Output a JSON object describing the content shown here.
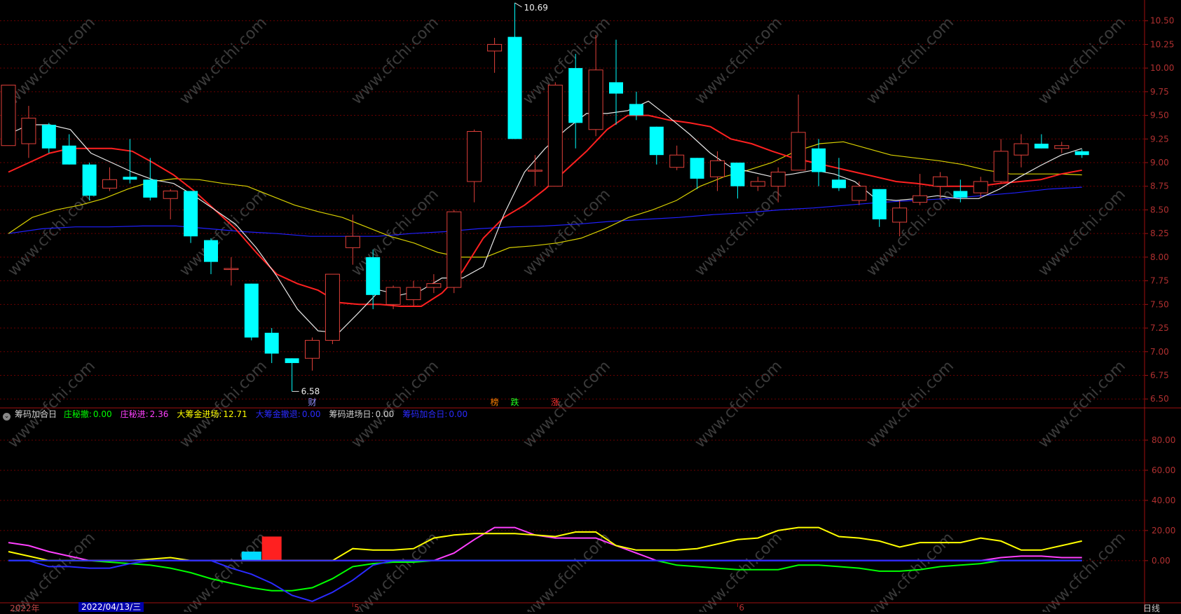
{
  "colors": {
    "background": "#000000",
    "up": "#e0403a",
    "down": "#00ffff",
    "ma5": "#e8e8e8",
    "ma10": "#ff2020",
    "ma20": "#d8d000",
    "ma60": "#2020ff",
    "axis": "#a01010",
    "grid": "#6a0000"
  },
  "price_axis_labels": [
    "10.50",
    "10.25",
    "10.00",
    "9.75",
    "9.50",
    "9.25",
    "9.00",
    "8.75",
    "8.50",
    "8.25",
    "8.00",
    "7.75",
    "7.50",
    "7.25",
    "7.00",
    "6.75",
    "6.50"
  ],
  "indicator_axis_labels": [
    "80.00",
    "60.00",
    "40.00",
    "20.00",
    "0.00"
  ],
  "high_label": "10.69",
  "low_label": "6.58",
  "event_markers": [
    {
      "text": "财",
      "color": "#9090ff",
      "bar": 15
    },
    {
      "text": "榜",
      "color": "#ff8000",
      "bar": 24
    },
    {
      "text": "跌",
      "color": "#20ff20",
      "bar": 25
    },
    {
      "text": "涨",
      "color": "#ff3030",
      "bar": 27
    }
  ],
  "indicator": {
    "name": "筹码加合日",
    "items": [
      {
        "label": "庄秘撤:",
        "value": "0.00",
        "color": "#00ff00"
      },
      {
        "label": "庄秘进:",
        "value": "2.36",
        "color": "#ff40ff"
      },
      {
        "label": "大筹金进场:",
        "value": "12.71",
        "color": "#ffff00"
      },
      {
        "label": "大筹金撤退:",
        "value": "0.00",
        "color": "#2a2aff"
      },
      {
        "label": "筹码进场日:",
        "value": "0.00",
        "color": "#d0d0d0"
      },
      {
        "label": "筹码加合日:",
        "value": "0.00",
        "color": "#2a2aff"
      }
    ]
  },
  "bottom_axis": {
    "year": "2022年",
    "current_date": "2022/04/13/三",
    "month_labels": [
      {
        "text": "5",
        "bar": 17
      },
      {
        "text": "6",
        "bar": 36
      }
    ],
    "period": "日线"
  },
  "watermark": "www.cfchi.com",
  "chart_data": [
    {
      "type": "candlestick",
      "ylim": [
        6.42,
        10.72
      ],
      "candles": [
        {
          "o": 9.18,
          "h": 9.82,
          "l": 9.18,
          "c": 9.82
        },
        {
          "o": 9.2,
          "h": 9.6,
          "l": 9.05,
          "c": 9.47
        },
        {
          "o": 9.4,
          "h": 9.42,
          "l": 9.1,
          "c": 9.15
        },
        {
          "o": 9.18,
          "h": 9.3,
          "l": 8.98,
          "c": 8.98
        },
        {
          "o": 8.98,
          "h": 9.0,
          "l": 8.6,
          "c": 8.65
        },
        {
          "o": 8.73,
          "h": 8.95,
          "l": 8.7,
          "c": 8.82
        },
        {
          "o": 8.85,
          "h": 9.25,
          "l": 8.78,
          "c": 8.82
        },
        {
          "o": 8.82,
          "h": 9.05,
          "l": 8.6,
          "c": 8.63
        },
        {
          "o": 8.62,
          "h": 8.72,
          "l": 8.4,
          "c": 8.7
        },
        {
          "o": 8.7,
          "h": 8.7,
          "l": 8.15,
          "c": 8.22
        },
        {
          "o": 8.18,
          "h": 8.2,
          "l": 7.82,
          "c": 7.95
        },
        {
          "o": 7.88,
          "h": 8.0,
          "l": 7.7,
          "c": 7.88
        },
        {
          "o": 7.72,
          "h": 7.72,
          "l": 7.12,
          "c": 7.15
        },
        {
          "o": 7.2,
          "h": 7.25,
          "l": 6.88,
          "c": 6.98
        },
        {
          "o": 6.93,
          "h": 6.93,
          "l": 6.58,
          "c": 6.88
        },
        {
          "o": 6.93,
          "h": 7.15,
          "l": 6.8,
          "c": 7.12
        },
        {
          "o": 7.12,
          "h": 7.82,
          "l": 7.08,
          "c": 7.82
        },
        {
          "o": 8.1,
          "h": 8.45,
          "l": 7.92,
          "c": 8.22
        },
        {
          "o": 8.0,
          "h": 8.08,
          "l": 7.45,
          "c": 7.6
        },
        {
          "o": 7.5,
          "h": 7.7,
          "l": 7.45,
          "c": 7.68
        },
        {
          "o": 7.55,
          "h": 7.75,
          "l": 7.48,
          "c": 7.68
        },
        {
          "o": 7.68,
          "h": 7.82,
          "l": 7.62,
          "c": 7.72
        },
        {
          "o": 7.68,
          "h": 8.5,
          "l": 7.62,
          "c": 8.48
        },
        {
          "o": 8.8,
          "h": 9.35,
          "l": 8.58,
          "c": 9.33
        },
        {
          "o": 10.18,
          "h": 10.32,
          "l": 9.95,
          "c": 10.25
        },
        {
          "o": 10.33,
          "h": 10.69,
          "l": 9.25,
          "c": 9.25
        },
        {
          "o": 8.92,
          "h": 9.08,
          "l": 8.75,
          "c": 8.92
        },
        {
          "o": 8.75,
          "h": 9.85,
          "l": 8.75,
          "c": 9.82
        },
        {
          "o": 10.0,
          "h": 10.15,
          "l": 9.15,
          "c": 9.42
        },
        {
          "o": 9.35,
          "h": 10.35,
          "l": 9.28,
          "c": 9.98
        },
        {
          "o": 9.85,
          "h": 10.3,
          "l": 9.4,
          "c": 9.73
        },
        {
          "o": 9.62,
          "h": 9.75,
          "l": 9.45,
          "c": 9.5
        },
        {
          "o": 9.38,
          "h": 9.38,
          "l": 8.98,
          "c": 9.08
        },
        {
          "o": 8.95,
          "h": 9.18,
          "l": 8.92,
          "c": 9.08
        },
        {
          "o": 9.05,
          "h": 9.05,
          "l": 8.72,
          "c": 8.83
        },
        {
          "o": 8.85,
          "h": 9.12,
          "l": 8.7,
          "c": 9.02
        },
        {
          "o": 9.0,
          "h": 9.0,
          "l": 8.62,
          "c": 8.75
        },
        {
          "o": 8.75,
          "h": 8.85,
          "l": 8.7,
          "c": 8.8
        },
        {
          "o": 8.75,
          "h": 8.95,
          "l": 8.58,
          "c": 8.9
        },
        {
          "o": 8.92,
          "h": 9.72,
          "l": 8.92,
          "c": 9.32
        },
        {
          "o": 9.15,
          "h": 9.25,
          "l": 8.75,
          "c": 8.9
        },
        {
          "o": 8.82,
          "h": 9.05,
          "l": 8.7,
          "c": 8.73
        },
        {
          "o": 8.6,
          "h": 8.8,
          "l": 8.55,
          "c": 8.75
        },
        {
          "o": 8.72,
          "h": 8.72,
          "l": 8.32,
          "c": 8.4
        },
        {
          "o": 8.37,
          "h": 8.6,
          "l": 8.22,
          "c": 8.52
        },
        {
          "o": 8.58,
          "h": 8.88,
          "l": 8.55,
          "c": 8.65
        },
        {
          "o": 8.75,
          "h": 8.9,
          "l": 8.62,
          "c": 8.85
        },
        {
          "o": 8.7,
          "h": 8.82,
          "l": 8.58,
          "c": 8.63
        },
        {
          "o": 8.68,
          "h": 8.85,
          "l": 8.63,
          "c": 8.8
        },
        {
          "o": 8.8,
          "h": 9.25,
          "l": 8.78,
          "c": 9.12
        },
        {
          "o": 9.08,
          "h": 9.3,
          "l": 8.95,
          "c": 9.2
        },
        {
          "o": 9.2,
          "h": 9.3,
          "l": 9.15,
          "c": 9.15
        },
        {
          "o": 9.15,
          "h": 9.22,
          "l": 9.1,
          "c": 9.18
        },
        {
          "o": 9.12,
          "h": 9.14,
          "l": 9.05,
          "c": 9.08
        }
      ],
      "ma5": [
        9.3,
        9.4,
        9.4,
        9.35,
        9.1,
        9.0,
        8.9,
        8.82,
        8.78,
        8.65,
        8.5,
        8.35,
        8.1,
        7.8,
        7.45,
        7.22,
        7.2,
        7.42,
        7.65,
        7.6,
        7.65,
        7.78,
        7.78,
        7.9,
        8.45,
        8.9,
        9.15,
        9.35,
        9.52,
        9.52,
        9.55,
        9.65,
        9.48,
        9.3,
        9.1,
        8.95,
        8.9,
        8.85,
        8.88,
        8.92,
        8.88,
        8.8,
        8.62,
        8.6,
        8.62,
        8.65,
        8.62,
        8.62,
        8.72,
        8.85,
        8.97,
        9.08,
        9.15
      ],
      "ma10": [
        8.9,
        9.0,
        9.1,
        9.15,
        9.15,
        9.15,
        9.12,
        9.0,
        8.87,
        8.7,
        8.5,
        8.3,
        8.05,
        7.82,
        7.72,
        7.65,
        7.52,
        7.5,
        7.5,
        7.48,
        7.48,
        7.62,
        7.85,
        8.2,
        8.42,
        8.55,
        8.72,
        8.92,
        9.12,
        9.35,
        9.5,
        9.5,
        9.45,
        9.42,
        9.38,
        9.25,
        9.2,
        9.12,
        9.05,
        9.0,
        8.95,
        8.9,
        8.85,
        8.8,
        8.78,
        8.75,
        8.75,
        8.75,
        8.78,
        8.8,
        8.82,
        8.88,
        8.92
      ],
      "ma20": [
        8.25,
        8.42,
        8.5,
        8.55,
        8.62,
        8.72,
        8.8,
        8.83,
        8.82,
        8.78,
        8.75,
        8.65,
        8.55,
        8.48,
        8.42,
        8.32,
        8.22,
        8.15,
        8.05,
        8.0,
        8.0,
        8.1,
        8.12,
        8.15,
        8.2,
        8.3,
        8.42,
        8.5,
        8.6,
        8.75,
        8.85,
        8.92,
        9.0,
        9.12,
        9.2,
        9.22,
        9.15,
        9.08,
        9.05,
        9.02,
        8.98,
        8.92,
        8.88,
        8.88,
        8.88,
        8.87
      ],
      "ma60": [
        8.25,
        8.3,
        8.32,
        8.32,
        8.33,
        8.33,
        8.3,
        8.27,
        8.25,
        8.22,
        8.22,
        8.22,
        8.25,
        8.27,
        8.3,
        8.32,
        8.33,
        8.35,
        8.38,
        8.4,
        8.42,
        8.45,
        8.47,
        8.5,
        8.52,
        8.55,
        8.58,
        8.6,
        8.62,
        8.65,
        8.68,
        8.72,
        8.74
      ],
      "ma_x": {
        "ma5_start": 0,
        "ma10_start": 0,
        "ma20_start": 0,
        "ma60_start": 0
      }
    },
    {
      "type": "line",
      "ylim": [
        -28,
        100
      ],
      "series": [
        {
          "name": "庄秘撤",
          "color": "#00ff00",
          "values": [
            0,
            0,
            0,
            0,
            0,
            -1,
            -2,
            -3,
            -5,
            -8,
            -12,
            -15,
            -18,
            -20,
            -20,
            -18,
            -12,
            -4,
            -2,
            -1,
            -1,
            0,
            0,
            0,
            0,
            0,
            0,
            0,
            0,
            0,
            0,
            0,
            0,
            -3,
            -4,
            -5,
            -6,
            -6,
            -6,
            -3,
            -3,
            -4,
            -5,
            -7,
            -7,
            -6,
            -4,
            -3,
            -2,
            0,
            0,
            0,
            0,
            0
          ]
        },
        {
          "name": "庄秘进",
          "color": "#ff40ff",
          "values": [
            12,
            10,
            6,
            3,
            0,
            0,
            0,
            0,
            0,
            0,
            0,
            0,
            0,
            0,
            0,
            0,
            0,
            0,
            0,
            0,
            0,
            0,
            5,
            14,
            22,
            22,
            17,
            15,
            15,
            15,
            10,
            5,
            0,
            0,
            0,
            0,
            0,
            0,
            0,
            0,
            0,
            0,
            0,
            0,
            0,
            0,
            0,
            0,
            0,
            2,
            3,
            3,
            2,
            2
          ]
        },
        {
          "name": "大筹金进场",
          "color": "#ffff00",
          "values": [
            6,
            3,
            0,
            0,
            0,
            0,
            0,
            1,
            2,
            0,
            0,
            0,
            0,
            0,
            0,
            0,
            0,
            8,
            7,
            7,
            8,
            15,
            17,
            18,
            18,
            18,
            17,
            16,
            19,
            19,
            10,
            7,
            7,
            7,
            8,
            11,
            14,
            15,
            20,
            22,
            22,
            16,
            15,
            13,
            9,
            12,
            12,
            12,
            15,
            13,
            7,
            7,
            10,
            13
          ]
        },
        {
          "name": "大筹金撤退",
          "color": "#2a2aff",
          "values": [
            0,
            0,
            -4,
            -4,
            -5,
            -5,
            -2,
            0,
            0,
            0,
            0,
            -5,
            -9,
            -15,
            -23,
            -27,
            -21,
            -13,
            -3,
            0,
            0,
            0,
            0,
            0,
            0,
            0,
            0,
            0,
            0,
            0,
            0,
            0,
            0,
            0,
            0,
            0,
            0,
            0,
            0,
            0,
            0,
            0,
            0,
            0,
            0,
            0,
            0,
            0,
            0,
            0,
            0,
            0,
            0,
            0
          ]
        },
        {
          "name": "筹码加合日",
          "color": "#2a2aff",
          "values": [
            0,
            0,
            0,
            0,
            0,
            0,
            0,
            0,
            0,
            0,
            0,
            0,
            0,
            0,
            0,
            0,
            0,
            0,
            0,
            0,
            0,
            0,
            0,
            0,
            0,
            0,
            0,
            0,
            0,
            0,
            0,
            0,
            0,
            0,
            0,
            0,
            0,
            0,
            0,
            0,
            0,
            0,
            0,
            0,
            0,
            0,
            0,
            0,
            0,
            0,
            0,
            0,
            0,
            0
          ]
        }
      ],
      "bars": [
        {
          "bar": 12,
          "value": 6,
          "color": "#00d8ff"
        },
        {
          "bar": 13,
          "value": 16,
          "color": "#ff2020"
        }
      ]
    }
  ]
}
